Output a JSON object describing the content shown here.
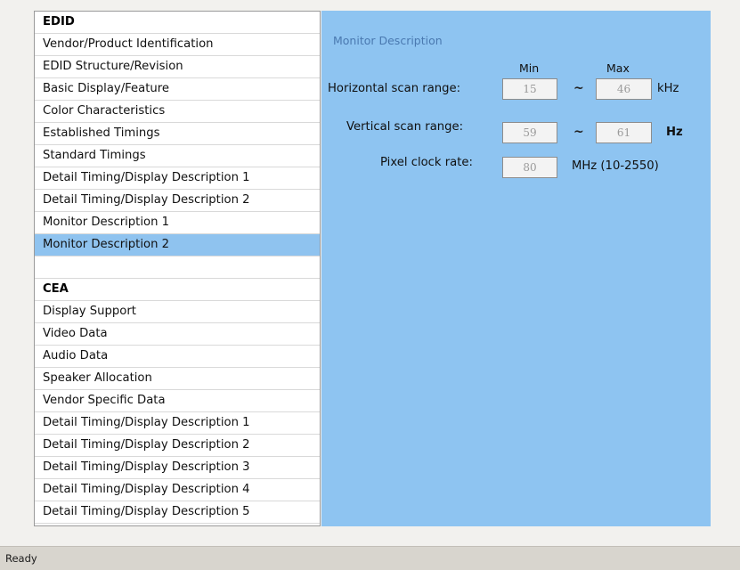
{
  "nav": {
    "edid_header": "EDID",
    "edid_items": [
      "Vendor/Product Identification",
      "EDID Structure/Revision",
      "Basic Display/Feature",
      "Color Characteristics",
      "Established Timings",
      "Standard Timings",
      "Detail Timing/Display Description 1",
      "Detail Timing/Display Description 2",
      "Monitor Description 1",
      "Monitor Description 2"
    ],
    "selected": "Monitor Description 2",
    "cea_header": "CEA",
    "cea_items": [
      "Display Support",
      "Video Data",
      "Audio Data",
      "Speaker Allocation",
      "Vendor Specific Data",
      "Detail Timing/Display Description 1",
      "Detail Timing/Display Description 2",
      "Detail Timing/Display Description 3",
      "Detail Timing/Display Description 4",
      "Detail Timing/Display Description 5"
    ]
  },
  "content": {
    "title": "Monitor Description",
    "min_label": "Min",
    "max_label": "Max",
    "horizontal": {
      "label": "Horizontal scan range:",
      "min": "15",
      "max": "46",
      "separator": "~",
      "unit": "kHz"
    },
    "vertical": {
      "label": "Vertical scan range:",
      "min": "59",
      "max": "61",
      "separator": "~",
      "unit": "Hz"
    },
    "pixel_clock": {
      "label": "Pixel clock rate:",
      "value": "80",
      "unit": "MHz (10-2550)"
    }
  },
  "status": {
    "text": "Ready"
  },
  "colors": {
    "content_bg": "#8ec4f1",
    "selected_row": "#8fc3ef",
    "title_blue": "#4a79b0"
  }
}
